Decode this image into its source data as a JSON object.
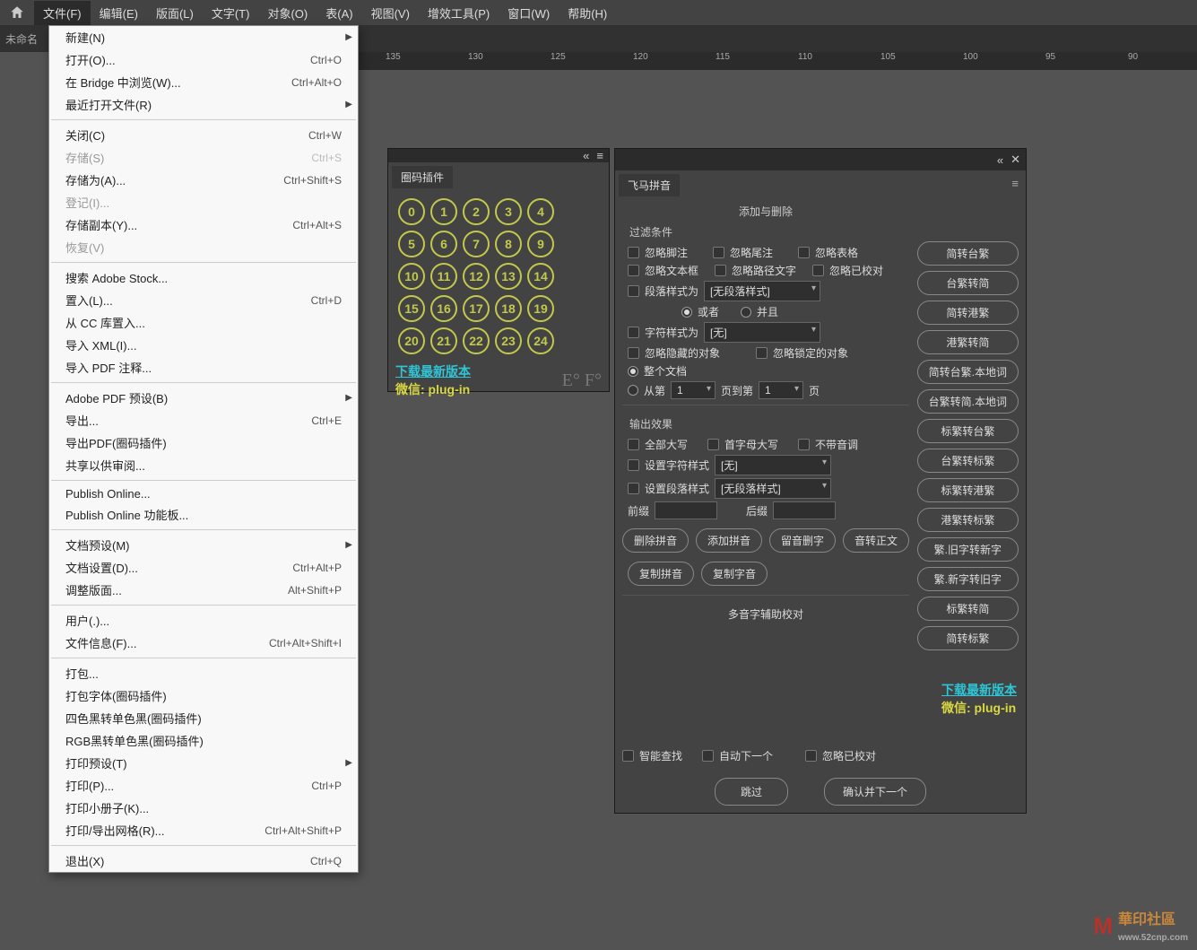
{
  "menubar": {
    "items": [
      "文件(F)",
      "编辑(E)",
      "版面(L)",
      "文字(T)",
      "对象(O)",
      "表(A)",
      "视图(V)",
      "增效工具(P)",
      "窗口(W)",
      "帮助(H)"
    ]
  },
  "tabbar": {
    "label": "未命名"
  },
  "ruler": {
    "ticks": [
      "135",
      "130",
      "125",
      "120",
      "115",
      "110",
      "105",
      "100",
      "95",
      "90"
    ]
  },
  "file_menu": [
    {
      "label": "新建(N)",
      "sub": true
    },
    {
      "label": "打开(O)...",
      "sc": "Ctrl+O"
    },
    {
      "label": "在 Bridge 中浏览(W)...",
      "sc": "Ctrl+Alt+O"
    },
    {
      "label": "最近打开文件(R)",
      "sub": true
    },
    {
      "sep": true
    },
    {
      "label": "关闭(C)",
      "sc": "Ctrl+W"
    },
    {
      "label": "存储(S)",
      "sc": "Ctrl+S",
      "disabled": true
    },
    {
      "label": "存储为(A)...",
      "sc": "Ctrl+Shift+S"
    },
    {
      "label": "登记(I)...",
      "disabled": true
    },
    {
      "label": "存储副本(Y)...",
      "sc": "Ctrl+Alt+S"
    },
    {
      "label": "恢复(V)",
      "disabled": true
    },
    {
      "sep": true
    },
    {
      "label": "搜索 Adobe Stock..."
    },
    {
      "label": "置入(L)...",
      "sc": "Ctrl+D"
    },
    {
      "label": "从 CC 库置入..."
    },
    {
      "label": "导入 XML(I)..."
    },
    {
      "label": "导入 PDF 注释..."
    },
    {
      "sep": true
    },
    {
      "label": "Adobe PDF 预设(B)",
      "sub": true
    },
    {
      "label": "导出...",
      "sc": "Ctrl+E"
    },
    {
      "label": "导出PDF(圈码插件)"
    },
    {
      "label": "共享以供审阅..."
    },
    {
      "sep": true
    },
    {
      "label": "Publish Online..."
    },
    {
      "label": "Publish Online 功能板..."
    },
    {
      "sep": true
    },
    {
      "label": "文档预设(M)",
      "sub": true
    },
    {
      "label": "文档设置(D)...",
      "sc": "Ctrl+Alt+P"
    },
    {
      "label": "调整版面...",
      "sc": "Alt+Shift+P"
    },
    {
      "sep": true
    },
    {
      "label": "用户(.)..."
    },
    {
      "label": "文件信息(F)...",
      "sc": "Ctrl+Alt+Shift+I"
    },
    {
      "sep": true
    },
    {
      "label": "打包..."
    },
    {
      "label": "打包字体(圈码插件)"
    },
    {
      "label": "四色黑转单色黑(圈码插件)"
    },
    {
      "label": "RGB黑转单色黑(圈码插件)"
    },
    {
      "label": "打印预设(T)",
      "sub": true
    },
    {
      "label": "打印(P)...",
      "sc": "Ctrl+P"
    },
    {
      "label": "打印小册子(K)..."
    },
    {
      "label": "打印/导出网格(R)...",
      "sc": "Ctrl+Alt+Shift+P"
    },
    {
      "sep": true
    },
    {
      "label": "退出(X)",
      "sc": "Ctrl+Q"
    }
  ],
  "panel1": {
    "title": "圈码插件",
    "numbers": [
      [
        "0",
        "1",
        "2",
        "3",
        "4"
      ],
      [
        "5",
        "6",
        "7",
        "8",
        "9"
      ],
      [
        "10",
        "11",
        "12",
        "13",
        "14"
      ],
      [
        "15",
        "16",
        "17",
        "18",
        "19"
      ],
      [
        "20",
        "21",
        "22",
        "23",
        "24"
      ]
    ],
    "ef": "E° F°",
    "download": "下载最新版本",
    "wechat": "微信: plug-in"
  },
  "panel2": {
    "title": "飞马拼音",
    "header": "添加与删除",
    "filter_title": "过滤条件",
    "chk1": "忽略脚注",
    "chk2": "忽略尾注",
    "chk3": "忽略表格",
    "chk4": "忽略文本框",
    "chk5": "忽略路径文字",
    "chk6": "忽略已校对",
    "para_style_lbl": "段落样式为",
    "para_style_val": "[无段落样式]",
    "or_lbl": "或者",
    "and_lbl": "并且",
    "char_style_lbl": "字符样式为",
    "char_style_val": "[无]",
    "chk_hidden": "忽略隐藏的对象",
    "chk_locked": "忽略锁定的对象",
    "whole_doc": "整个文档",
    "from_page": "从第",
    "page_val1": "1",
    "to_page": "页到第",
    "page_val2": "1",
    "page_suf": "页",
    "output_title": "输出效果",
    "all_caps": "全部大写",
    "initial_caps": "首字母大写",
    "no_tone": "不带音调",
    "set_char": "设置字符样式",
    "set_char_val": "[无]",
    "set_para": "设置段落样式",
    "set_para_val": "[无段落样式]",
    "prefix": "前缀",
    "suffix": "后缀",
    "btns1": [
      "删除拼音",
      "添加拼音",
      "留音删字",
      "音转正文"
    ],
    "btns2": [
      "复制拼音",
      "复制字音"
    ],
    "poly_title": "多音字辅助校对",
    "smart_find": "智能查找",
    "auto_next": "自动下一个",
    "ignore_checked": "忽略已校对",
    "skip_btn": "跳过",
    "confirm_btn": "确认并下一个",
    "download": "下载最新版本",
    "wechat": "微信: plug-in",
    "side_btns": [
      "简转台繁",
      "台繁转简",
      "简转港繁",
      "港繁转简",
      "简转台繁.本地词",
      "台繁转简.本地词",
      "标繁转台繁",
      "台繁转标繁",
      "标繁转港繁",
      "港繁转标繁",
      "繁.旧字转新字",
      "繁.新字转旧字",
      "标繁转简",
      "简转标繁"
    ]
  },
  "watermark": {
    "text": "華印社區",
    "url": "www.52cnp.com"
  }
}
